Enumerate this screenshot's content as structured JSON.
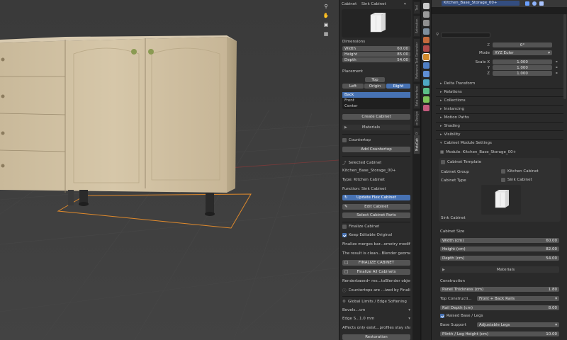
{
  "outliner": {
    "row_label": "Kitchen_Base_Storage_00+"
  },
  "npanel": {
    "top_tab": "Cabinet",
    "top_dropdown": "Sink Cabinet",
    "dimensions_title": "Dimensions",
    "dims": [
      {
        "label": "Width",
        "value": "60.00"
      },
      {
        "label": "Height",
        "value": "85.00"
      },
      {
        "label": "Depth",
        "value": "54.00"
      }
    ],
    "placement_title": "Placement",
    "placement_top": "Top",
    "placement_left": "Left",
    "placement_origin": "Origin",
    "placement_right": "Right",
    "side_list": [
      "Back",
      "Front",
      "Center"
    ],
    "create_cabinet": "Create Cabinet",
    "materials": "Materials",
    "countertop": "Countertop",
    "add_countertop": "Add Countertop",
    "selected_title": "Selected Cabinet",
    "selected_name": "Kitchen_Base_Storage_00+",
    "type_line": "Type: Kitchen Cabinet",
    "function_line": "Function: Sink Cabinet",
    "update_btn": "Update Flex Cabinet",
    "edit_btn": "Edit Cabinet",
    "select_parts_btn": "Select Cabinet Parts",
    "finalize_title": "Finalize Cabinet",
    "keep_editable": "Keep Editable Original",
    "finalize_note1": "Finalize merges bar...ometry modifiers",
    "finalize_note2": "The result is clean...Blender geometry",
    "finalize_btn": "FINALIZE CABINET",
    "finalize_all_btn": "Finalize All Cabinets",
    "renderbased_note": "Renderbased• res...toBlender objects",
    "countertops_note": "Countertops are ...ized by Finalize",
    "global_limits": "Global Limits / Edge Softening",
    "bevel_label": "Bevels...",
    "bevel_value": "cm",
    "edge_label": "Edge S...",
    "edge_value": "1.0 mm",
    "affects_note": "Affects only exist...profiles stay sharp",
    "bottom_btn": "Restoration"
  },
  "vtabs": [
    "Tool",
    "Animation",
    "Reference Text Generator",
    "Beta Interface",
    "Flex Designer",
    "FBX",
    "MetaCab"
  ],
  "props": {
    "search_placeholder": "",
    "z_label": "Z",
    "z_value": "0°",
    "mode_label": "Mode",
    "mode_value": "XYZ Euler",
    "scale_x_label": "Scale X",
    "scale_x": "1.000",
    "scale_y_label": "Y",
    "scale_y": "1.000",
    "scale_z_label": "Z",
    "scale_z": "1.000",
    "sections": [
      "Delta Transform",
      "Relations",
      "Collections",
      "Instancing",
      "Motion Paths",
      "Shading",
      "Visibility",
      "Cabinet Module Settings"
    ],
    "module_label": "Module: Kitchen_Base_Storage_00+",
    "cabinet_template": "Cabinet Template",
    "cabinet_group_label": "Cabinet Group",
    "cabinet_group_value": "Kitchen Cabinet",
    "cabinet_type_label": "Cabinet Type",
    "cabinet_type_value": "Sink Cabinet",
    "preview_caption": "Sink Cabinet",
    "cabinet_size": "Cabinet Size",
    "size_fields": [
      {
        "label": "Width (cm)",
        "value": "60.00"
      },
      {
        "label": "Height (cm)",
        "value": "82.00"
      },
      {
        "label": "Depth (cm)",
        "value": "54.00"
      }
    ],
    "materials": "Materials",
    "construction": "Construction",
    "panel_thickness_label": "Panel Thickness (cm)",
    "panel_thickness_value": "1.80",
    "top_construction_label": "Top Constructi...",
    "top_construction_value": "Front + Back Rails",
    "rail_depth_label": "Rail Depth (cm)",
    "rail_depth_value": "8.00",
    "raised_base": "Raised Base / Legs",
    "base_support_label": "Base Support",
    "base_support_value": "Adjustable Legs",
    "plinth_label": "Plinth / Leg Height (cm)",
    "plinth_value": "10.00"
  },
  "colors": {
    "accent": "#4772b3",
    "panel": "#2b2b2b",
    "field": "#545454",
    "selection": "#ff9a3c"
  }
}
